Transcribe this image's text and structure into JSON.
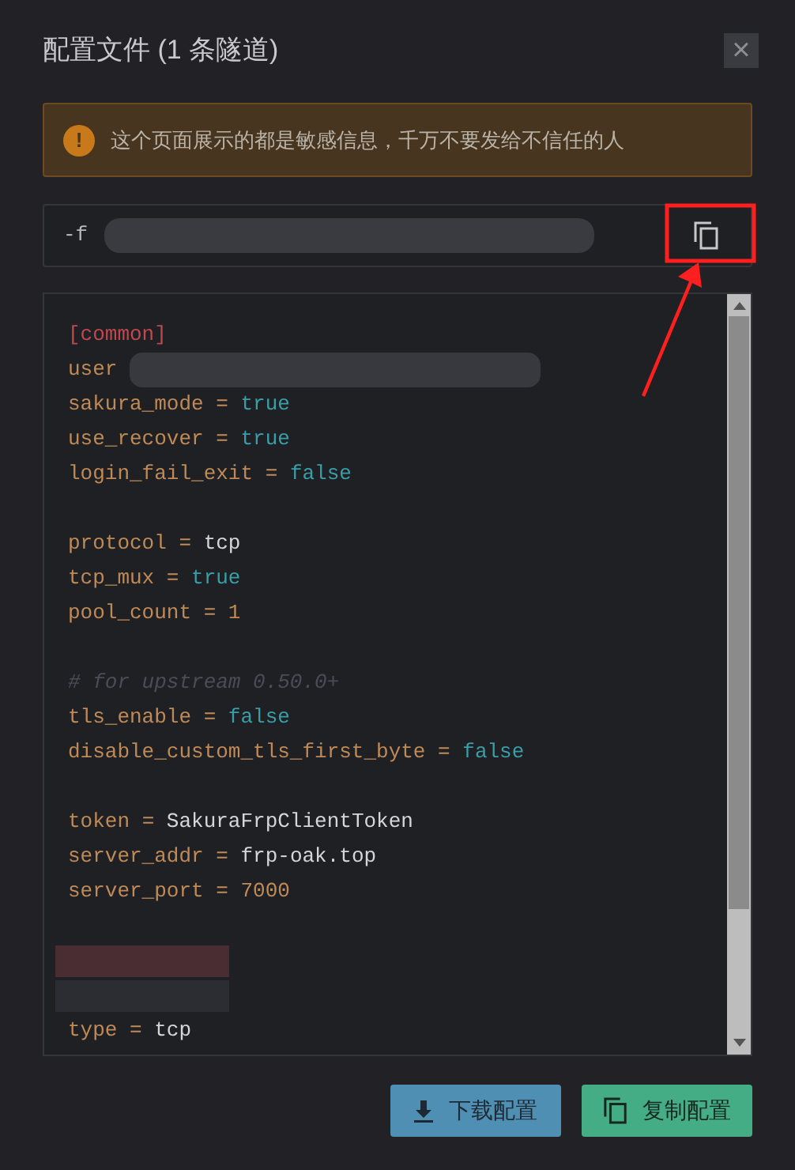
{
  "dialog": {
    "title": "配置文件 (1 条隧道)",
    "close": "×"
  },
  "warning": {
    "icon": "!",
    "text": "这个页面展示的都是敏感信息，千万不要发给不信任的人"
  },
  "command": {
    "prefix": "-f"
  },
  "config_lines": [
    {
      "kind": "section",
      "text": "[common]"
    },
    {
      "kind": "masked_pair",
      "key": "user"
    },
    {
      "kind": "pair",
      "key": "sakura_mode",
      "operator": "=",
      "value": "true",
      "color": "#3a9ea8"
    },
    {
      "kind": "pair",
      "key": "use_recover",
      "operator": "=",
      "value": "true",
      "color": "#3a9ea8"
    },
    {
      "kind": "pair",
      "key": "login_fail_exit",
      "operator": "=",
      "value": "false",
      "color": "#3a9ea8"
    },
    {
      "kind": "blank"
    },
    {
      "kind": "pair",
      "key": "protocol",
      "operator": "=",
      "value": "tcp",
      "color": "#d6d6d6"
    },
    {
      "kind": "pair",
      "key": "tcp_mux",
      "operator": "=",
      "value": "true",
      "color": "#3a9ea8"
    },
    {
      "kind": "pair",
      "key": "pool_count",
      "operator": "=",
      "value": "1",
      "color": "#c08a57"
    },
    {
      "kind": "blank"
    },
    {
      "kind": "comment",
      "text": "# for upstream 0.50.0+"
    },
    {
      "kind": "pair",
      "key": "tls_enable",
      "operator": "=",
      "value": "false",
      "color": "#3a9ea8"
    },
    {
      "kind": "pair",
      "key": "disable_custom_tls_first_byte",
      "operator": "=",
      "value": "false",
      "color": "#3a9ea8"
    },
    {
      "kind": "blank"
    },
    {
      "kind": "pair",
      "key": "token",
      "operator": "=",
      "value": "SakuraFrpClientToken",
      "color": "#d6d6d6"
    },
    {
      "kind": "pair",
      "key": "server_addr",
      "operator": "=",
      "value": "frp-oak.top",
      "color": "#d6d6d6"
    },
    {
      "kind": "pair",
      "key": "server_port",
      "operator": "=",
      "value": "7000",
      "color": "#c08a57"
    },
    {
      "kind": "blank"
    },
    {
      "kind": "redacted",
      "color": "#4a2c33"
    },
    {
      "kind": "redacted",
      "color": "#2c2d33"
    },
    {
      "kind": "pair",
      "key": "type",
      "operator": "=",
      "value": "tcp",
      "color": "#d6d6d6"
    }
  ],
  "buttons": [
    {
      "kind": "download",
      "label": "下载配置"
    },
    {
      "kind": "copy",
      "label": "复制配置"
    }
  ]
}
